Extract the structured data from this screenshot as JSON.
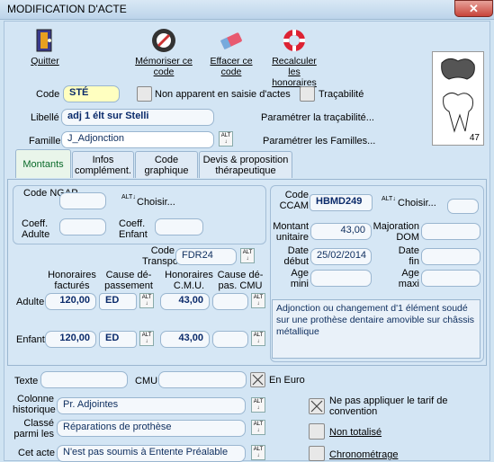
{
  "window": {
    "title": "MODIFICATION D'ACTE",
    "close": "✕"
  },
  "toolbar": {
    "quit": "Quitter",
    "memorize": "Mémoriser ce code",
    "erase": "Effacer ce code",
    "recalc": "Recalculer les honoraires"
  },
  "header": {
    "code_label": "Code",
    "code_value": "STÉ",
    "nonapp_label": "Non apparent en saisie d'actes",
    "trace_label": "Traçabilité",
    "libelle_label": "Libellé",
    "libelle_value": "adj 1 élt sur Stelli",
    "famille_label": "Famille",
    "famille_value": "J_Adjonction",
    "param_trace": "Paramétrer la traçabilité...",
    "param_fam": "Paramétrer les Familles...",
    "tooth_number": "47"
  },
  "tabs": [
    "Montants",
    "Infos complément.",
    "Code graphique",
    "Devis & proposition thérapeutique"
  ],
  "montants": {
    "code_ngap": "Code NGAP",
    "choisir": "Choisir...",
    "coeff_adulte": "Coeff. Adulte",
    "coeff_enfant": "Coeff. Enfant",
    "code_transpo": "Code Transpo",
    "transpo_value": "FDR24",
    "h_fact": "Honoraires facturés",
    "cause_dep": "Cause dé- passement",
    "h_cmu": "Honoraires C.M.U.",
    "cause_cmu": "Cause dé- pas. CMU",
    "adulte": "Adulte",
    "adulte_hf": "120,00",
    "adulte_cause": "ED",
    "adulte_cmu": "43,00",
    "enfant": "Enfant",
    "enfant_hf": "120,00",
    "enfant_cause": "ED",
    "enfant_cmu": "43,00",
    "ccam_label": "Code CCAM",
    "ccam_value": "HBMD249",
    "ccam_choisir": "Choisir...",
    "montant_unit": "Montant unitaire",
    "montant_value": "43,00",
    "majoration": "Majoration DOM",
    "date_debut": "Date début",
    "date_debut_value": "25/02/2014",
    "date_fin": "Date fin",
    "age_mini": "Age mini",
    "age_maxi": "Age maxi",
    "description": "Adjonction ou changement d'1 élément soudé sur une prothèse dentaire amovible sur châssis métallique"
  },
  "bottom": {
    "texte": "Texte",
    "cmu": "CMU",
    "en_euro": "En Euro",
    "col_hist": "Colonne historique",
    "col_hist_value": "Pr. Adjointes",
    "classe": "Classé parmi les",
    "classe_value": "Réparations de prothèse",
    "cet_acte": "Cet acte",
    "cet_acte_value": "N'est pas soumis à Entente Préalable",
    "ne_pas": "Ne pas appliquer le tarif de convention",
    "non_total": "Non totalisé",
    "chrono": "Chronométrage"
  },
  "colors": {
    "accent": "#0a2a6a",
    "background": "#d3e5f4",
    "active_tab": "#0a6a2a"
  }
}
